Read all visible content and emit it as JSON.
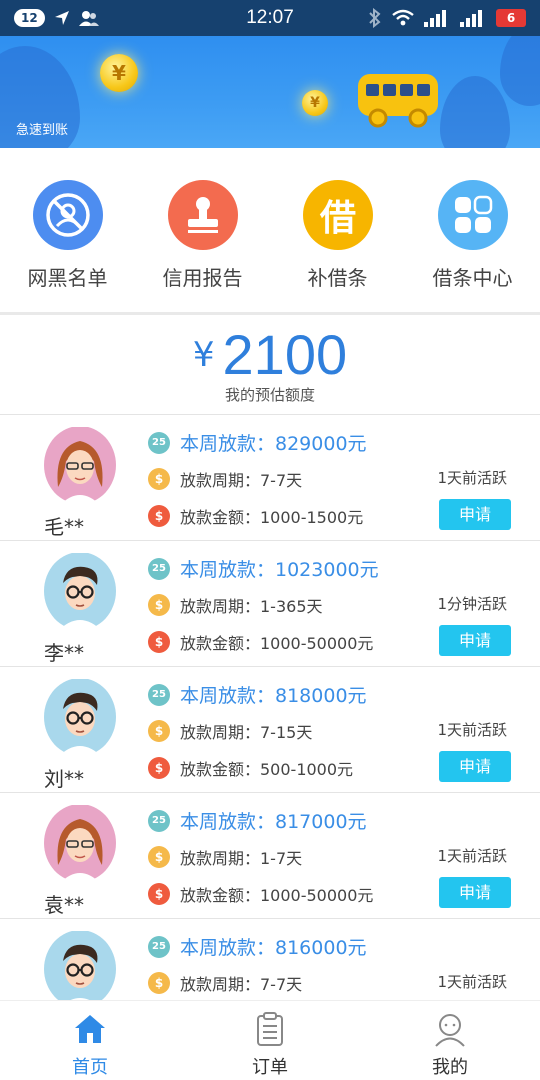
{
  "status_bar": {
    "notification_count": "12",
    "time": "12:07",
    "battery": "6",
    "icons": [
      "location-arrow-icon",
      "contacts-icon",
      "bluetooth-icon",
      "wifi-icon",
      "signal-icon"
    ]
  },
  "banner": {
    "caption": "急速到账",
    "coin_symbol": "¥"
  },
  "quick_nav": [
    {
      "label": "网黑名单",
      "icon": "blacklist-icon",
      "color": "#4d8df0"
    },
    {
      "label": "信用报告",
      "icon": "stamp-icon",
      "color": "#f36b4f"
    },
    {
      "label": "补借条",
      "icon": "borrow-note-icon",
      "glyph": "借",
      "color": "#f7b500"
    },
    {
      "label": "借条中心",
      "icon": "grid-icon",
      "color": "#56b4f5"
    }
  ],
  "quota": {
    "currency": "¥",
    "amount": "2100",
    "label": "我的预估额度"
  },
  "lenders": [
    {
      "name": "毛**",
      "avatar": "female",
      "week": "本周放款：829000元",
      "period": "放款周期：7-7天",
      "amount": "放款金额：1000-1500元",
      "activity": "1天前活跃",
      "button": "申请"
    },
    {
      "name": "李**",
      "avatar": "male",
      "week": "本周放款：1023000元",
      "period": "放款周期：1-365天",
      "amount": "放款金额：1000-50000元",
      "activity": "1分钟活跃",
      "button": "申请"
    },
    {
      "name": "刘**",
      "avatar": "male",
      "week": "本周放款：818000元",
      "period": "放款周期：7-15天",
      "amount": "放款金额：500-1000元",
      "activity": "1天前活跃",
      "button": "申请"
    },
    {
      "name": "袁**",
      "avatar": "female",
      "week": "本周放款：817000元",
      "period": "放款周期：1-7天",
      "amount": "放款金额：1000-50000元",
      "activity": "1天前活跃",
      "button": "申请"
    },
    {
      "name": "",
      "avatar": "male",
      "week": "本周放款：816000元",
      "period": "放款周期：7-7天",
      "amount": "",
      "activity": "1天前活跃",
      "button": ""
    }
  ],
  "icon_badges": {
    "calendar": "25",
    "money_bag": "$",
    "dollar": "$"
  },
  "tab_bar": [
    {
      "label": "首页",
      "icon": "home-icon",
      "active": true
    },
    {
      "label": "订单",
      "icon": "clipboard-icon",
      "active": false
    },
    {
      "label": "我的",
      "icon": "user-icon",
      "active": false
    }
  ],
  "colors": {
    "status_bar": "#16416f",
    "accent_blue": "#2f8ae6",
    "apply_button": "#23c5ef",
    "banner": "#3d9cf3"
  }
}
